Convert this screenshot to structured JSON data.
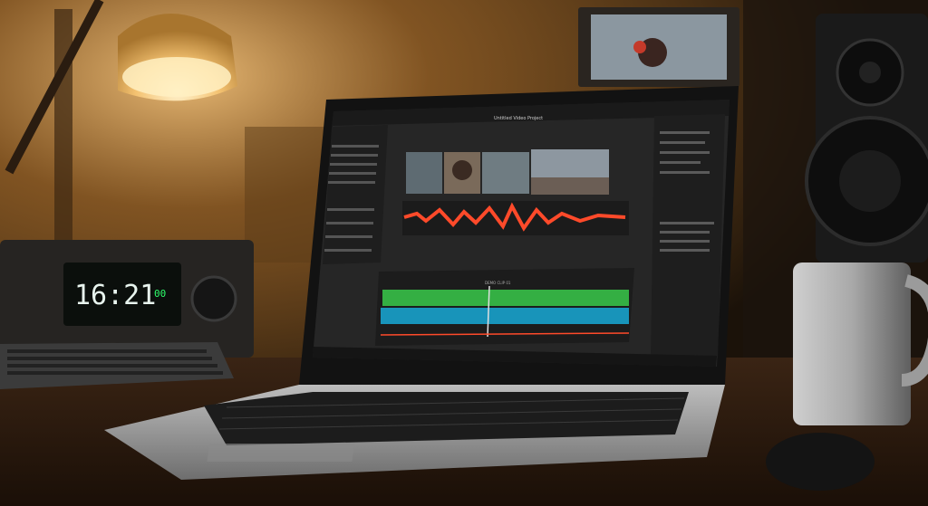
{
  "scene": {
    "description": "Laptop on a wooden desk running a video editing application; lamp, speaker, mug and digital clock radio in a dim warm room",
    "clock": {
      "time": "16:21",
      "extra": "00"
    },
    "editor": {
      "title": "Untitled Video Project",
      "timeline_label": "DEMO CLIP 01"
    },
    "colors": {
      "lamp_glow": "#f6c77a",
      "waveform_red": "#ff4a2a",
      "waveform_green": "#38c94a",
      "waveform_blue": "#18a9d6",
      "lcd_green": "#2dff6b",
      "wall": "#4a2f12",
      "desk": "#2a1a0e"
    }
  }
}
